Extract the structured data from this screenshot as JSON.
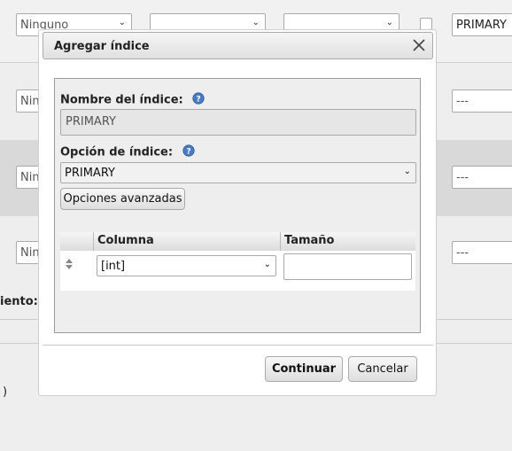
{
  "background": {
    "row1": {
      "select1": "Ninguno",
      "text_right": "PRIMARY"
    },
    "row2": {
      "select1": "Nin",
      "text_right": "---"
    },
    "row3": {
      "select1": "Nin",
      "text_right": "---"
    },
    "row4": {
      "select1": "Nin",
      "text_right": "---"
    },
    "label_partial": "iento:",
    "paren": ")"
  },
  "dialog": {
    "title": "Agregar índice",
    "index_name_label": "Nombre del índice:",
    "index_name_value": "PRIMARY",
    "index_option_label": "Opción de índice:",
    "index_option_value": "PRIMARY",
    "advanced_button": "Opciones avanzadas",
    "table": {
      "col_column": "Columna",
      "col_size": "Tamaño",
      "row_column_value": "[int]",
      "row_size_value": ""
    },
    "continue_button": "Continuar",
    "cancel_button": "Cancelar"
  },
  "colors": {
    "help_icon": "#3b6fb6",
    "band_dark": "#d9d9d9"
  },
  "icons": {
    "help": "help-circle-icon",
    "close": "close-icon",
    "sort": "sort-arrows-icon"
  }
}
